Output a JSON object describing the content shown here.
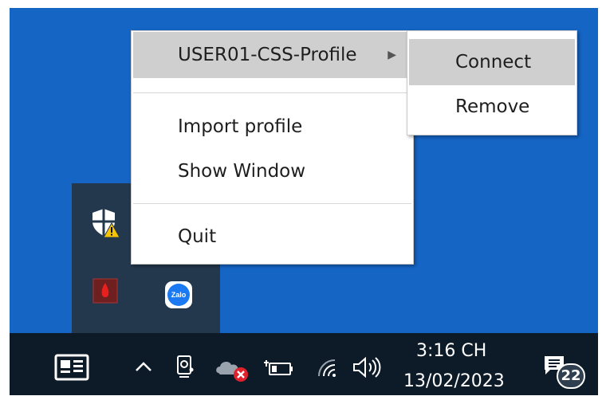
{
  "menu": {
    "profile_label": "USER01-CSS-Profile",
    "import_label": "Import profile",
    "show_window_label": "Show Window",
    "quit_label": "Quit",
    "submenu": {
      "connect_label": "Connect",
      "remove_label": "Remove"
    }
  },
  "tray_overflow": {
    "icons": [
      "security-warning-icon",
      "red-app-icon",
      "zalo-icon"
    ],
    "zalo_text": "Zalo"
  },
  "taskbar": {
    "time": "3:16 CH",
    "date": "13/02/2023",
    "notification_count": "22",
    "icons": [
      "news-widget-icon",
      "chevron-up-icon",
      "camera-icon",
      "onedrive-error-icon",
      "battery-icon",
      "wifi-icon",
      "speaker-icon",
      "notification-icon"
    ]
  },
  "colors": {
    "desktop": "#1565c5",
    "taskbar": "#0d1a28",
    "tray_overflow": "#24384d",
    "menu_highlight": "#cfcfcf"
  }
}
